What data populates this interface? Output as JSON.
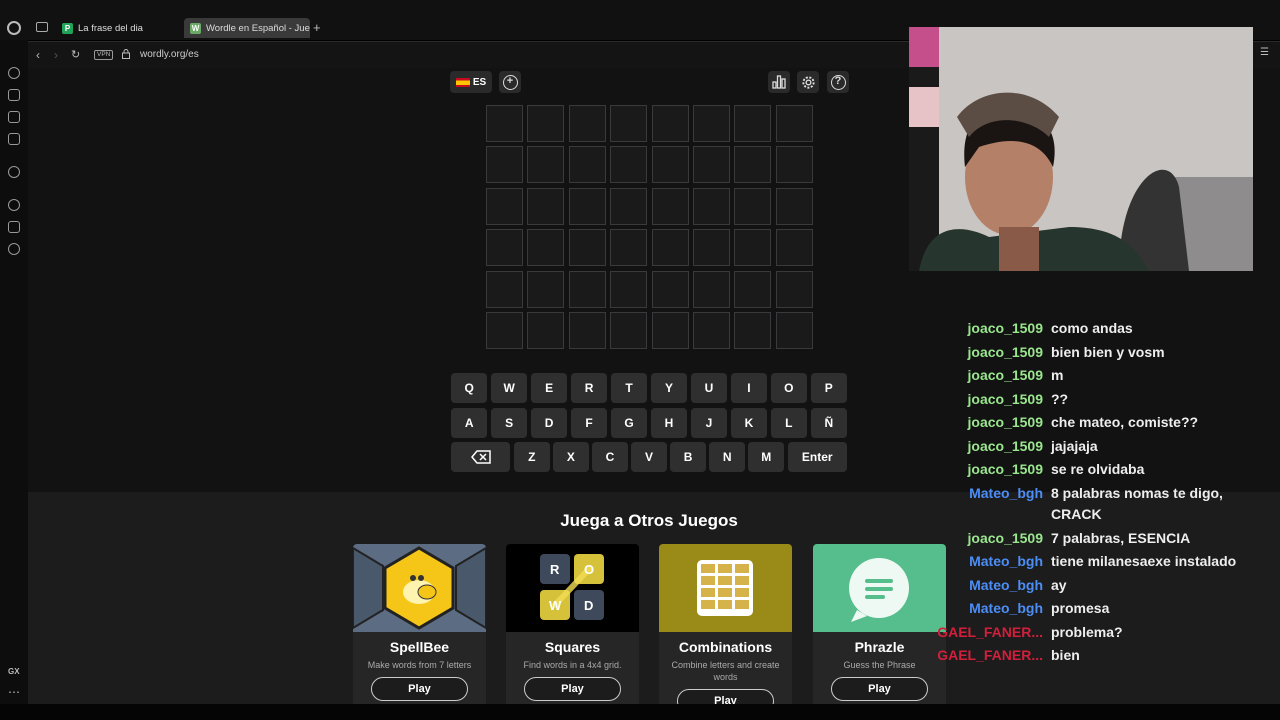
{
  "browser": {
    "tabs": [
      {
        "favicon": "P",
        "label": "La frase del dia"
      },
      {
        "favicon": "W",
        "label": "Wordle en Español - Juego",
        "active": true
      }
    ],
    "new_tab_label": "+",
    "url": "wordly.org/es",
    "vpn_label": "VPN",
    "sidebar_bottom_label": "GX"
  },
  "game": {
    "language_code": "ES",
    "board_rows": 6,
    "board_cols": 8,
    "keyboard": {
      "row1": [
        "Q",
        "W",
        "E",
        "R",
        "T",
        "Y",
        "U",
        "I",
        "O",
        "P"
      ],
      "row2": [
        "A",
        "S",
        "D",
        "F",
        "G",
        "H",
        "J",
        "K",
        "L",
        "Ñ"
      ],
      "row3": [
        "Z",
        "X",
        "C",
        "V",
        "B",
        "N",
        "M"
      ],
      "enter_label": "Enter"
    }
  },
  "other_games": {
    "title": "Juega a Otros Juegos",
    "cards": [
      {
        "name": "SpellBee",
        "desc": "Make words from 7 letters",
        "play": "Play",
        "color": "#5b6c83"
      },
      {
        "name": "Squares",
        "desc": "Find words in a 4x4 grid.",
        "play": "Play",
        "color": "#000000"
      },
      {
        "name": "Combinations",
        "desc": "Combine letters and create words",
        "play": "Play",
        "color": "#9a8a17"
      },
      {
        "name": "Phrazle",
        "desc": "Guess the Phrase",
        "play": "Play",
        "color": "#56be8c"
      }
    ],
    "squares_letters": [
      "R",
      "O",
      "W",
      "D"
    ]
  },
  "chat": [
    {
      "user": "joaco_1509",
      "msg": "como andas",
      "color": "green"
    },
    {
      "user": "joaco_1509",
      "msg": "bien bien y vosm",
      "color": "green"
    },
    {
      "user": "joaco_1509",
      "msg": "m",
      "color": "green"
    },
    {
      "user": "joaco_1509",
      "msg": "??",
      "color": "green"
    },
    {
      "user": "joaco_1509",
      "msg": "che mateo, comiste??",
      "color": "green"
    },
    {
      "user": "joaco_1509",
      "msg": "jajajaja",
      "color": "green"
    },
    {
      "user": "joaco_1509",
      "msg": "se re olvidaba",
      "color": "green"
    },
    {
      "user": "Mateo_bgh",
      "msg": "8 palabras nomas te digo, CRACK",
      "color": "blue"
    },
    {
      "user": "joaco_1509",
      "msg": "7 palabras, ESENCIA",
      "color": "green"
    },
    {
      "user": "Mateo_bgh",
      "msg": "tiene milanesaexe instalado",
      "color": "blue"
    },
    {
      "user": "Mateo_bgh",
      "msg": "ay",
      "color": "blue"
    },
    {
      "user": "Mateo_bgh",
      "msg": "promesa",
      "color": "blue"
    },
    {
      "user": "GAEL_FANER...",
      "msg": "problema?",
      "color": "red"
    },
    {
      "user": "GAEL_FANER...",
      "msg": "bien",
      "color": "red"
    }
  ]
}
